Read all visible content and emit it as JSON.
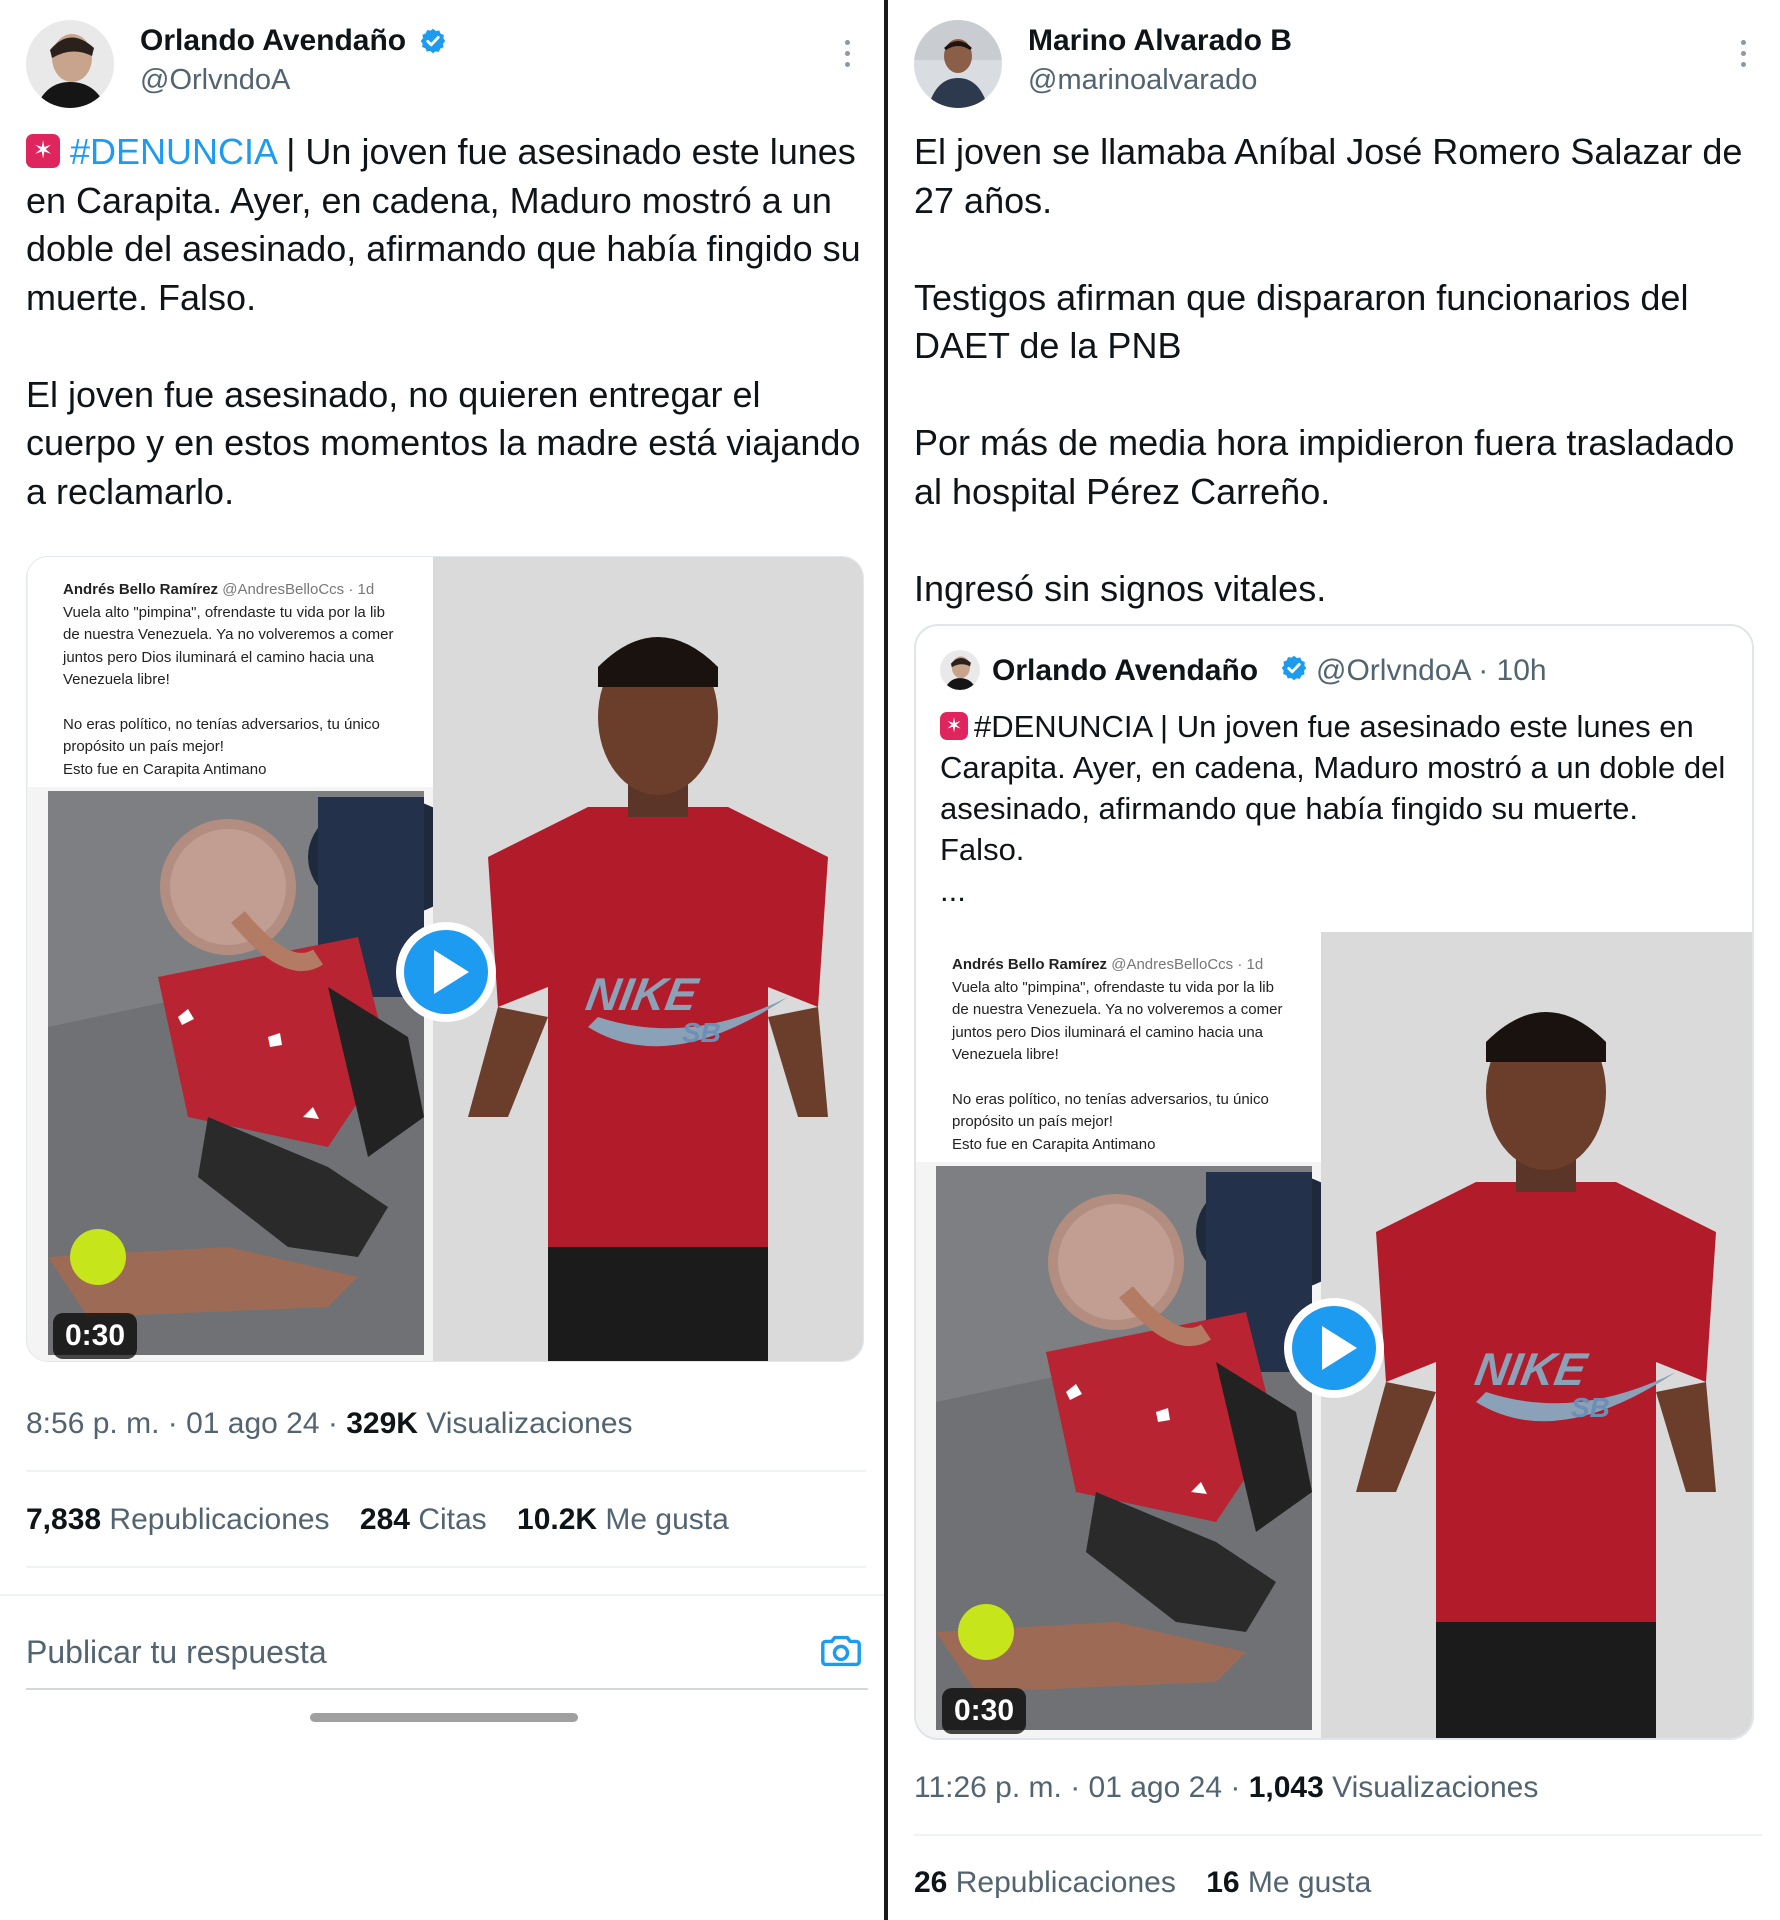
{
  "left_tweet": {
    "author": {
      "name": "Orlando Avendaño",
      "handle": "@OrlvndoA",
      "verified": true
    },
    "text": {
      "hashtag": "#DENUNCIA",
      "p1_rest": " | Un joven fue asesinado este lunes en Carapita. Ayer, en cadena, Maduro mostró a un doble del asesinado, afirmando que había fingido su muerte. Falso.",
      "p2": "El joven fue asesinado, no quieren entregar el cuerpo y en estos momentos la madre está viajando a reclamarlo."
    },
    "video": {
      "duration": "0:30",
      "embedded_post": {
        "name": "Andrés Bello Ramírez",
        "handle_time": "@AndresBelloCcs · 1d",
        "text_lines": [
          "Vuela alto \"pimpina\", ofrendaste tu vida por la lib",
          "de nuestra Venezuela. Ya no volveremos a comer",
          "juntos pero Dios iluminará el camino hacia una",
          "Venezuela libre!",
          "",
          "No eras político, no tenías  adversarios, tu único",
          "propósito un país mejor!",
          "Esto fue en Carapita Antimano"
        ]
      },
      "shirt_logo": "NIKE",
      "shirt_logo_sub": "SB"
    },
    "meta": {
      "time": "8:56 p. m.",
      "date": "01 ago 24",
      "views_count": "329K",
      "views_label": "Visualizaciones"
    },
    "stats": [
      {
        "count": "7,838",
        "label": "Republicaciones"
      },
      {
        "count": "284",
        "label": "Citas"
      },
      {
        "count": "10.2K",
        "label": "Me gusta"
      }
    ],
    "reply_placeholder": "Publicar tu respuesta"
  },
  "right_tweet": {
    "author": {
      "name": "Marino Alvarado B",
      "handle": "@marinoalvarado",
      "verified": false
    },
    "paragraphs": [
      "El joven se llamaba Aníbal José Romero Salazar de 27 años.",
      "Testigos afirman que dispararon funcionarios del DAET de la PNB",
      "Por más de media hora impidieron fuera trasladado al hospital Pérez Carreño.",
      "Ingresó sin signos vitales."
    ],
    "quote": {
      "name": "Orlando Avendaño",
      "handle_time": "@OrlvndoA · 10h",
      "hashtag": "#DENUNCIA",
      "text_rest": " | Un joven fue asesinado este lunes en Carapita. Ayer, en cadena, Maduro mostró a un doble del asesinado, afirmando que había fingido su muerte. Falso.",
      "ellipsis": "...",
      "video_duration": "0:30"
    },
    "meta": {
      "time": "11:26 p. m.",
      "date": "01 ago 24",
      "views_count": "1,043",
      "views_label": "Visualizaciones"
    },
    "stats": [
      {
        "count": "26",
        "label": "Republicaciones"
      },
      {
        "count": "16",
        "label": "Me gusta"
      }
    ]
  },
  "colors": {
    "accent": "#1d9bf0",
    "text": "#0f1419",
    "secondary": "#536471",
    "siren": "#e0245e"
  },
  "icons": [
    "verified-badge-icon",
    "more-options-icon",
    "siren-emoji-icon",
    "play-icon",
    "camera-icon"
  ]
}
